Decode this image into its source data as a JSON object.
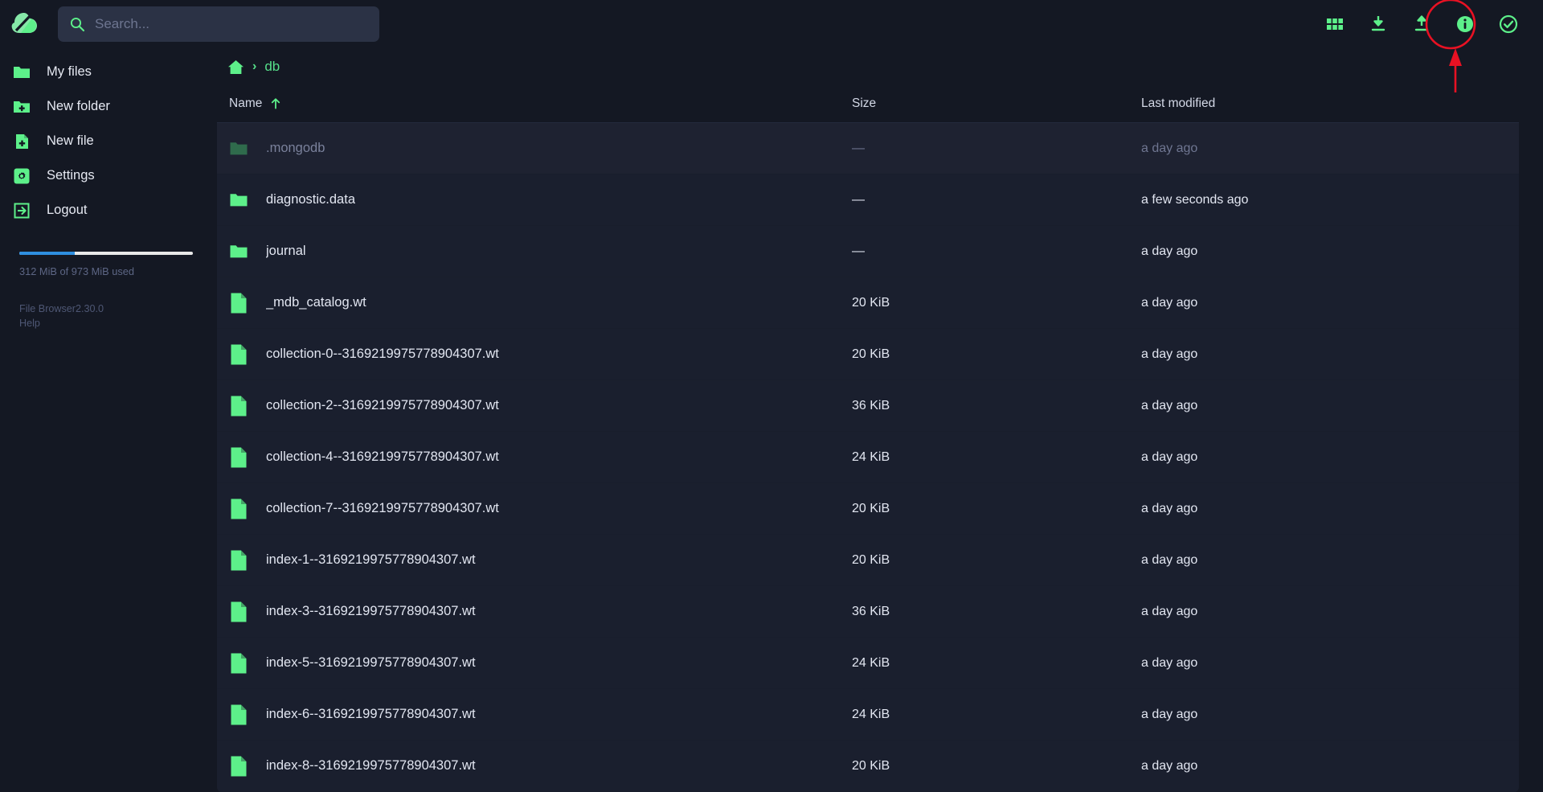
{
  "app": {
    "name": "File Browser",
    "version": "2.30.0",
    "help_label": "Help"
  },
  "search": {
    "placeholder": "Search...",
    "value": "",
    "icon": "search-icon"
  },
  "toolbar": {
    "items": [
      {
        "name": "switch-view-icon",
        "label": "Switch view"
      },
      {
        "name": "download-icon",
        "label": "Download"
      },
      {
        "name": "upload-icon",
        "label": "Upload"
      },
      {
        "name": "info-icon",
        "label": "Info"
      },
      {
        "name": "select-multiple-icon",
        "label": "Select multiple"
      }
    ],
    "highlighted": "upload-icon"
  },
  "sidebar": {
    "items": [
      {
        "icon": "folder-icon",
        "label": "My files"
      },
      {
        "icon": "folder-plus-icon",
        "label": "New folder"
      },
      {
        "icon": "file-plus-icon",
        "label": "New file"
      },
      {
        "icon": "gear-icon",
        "label": "Settings"
      },
      {
        "icon": "logout-icon",
        "label": "Logout"
      }
    ],
    "usage": {
      "text": "312 MiB of 973 MiB used",
      "percent": 32,
      "fill_color": "#2f8fe0",
      "track_color": "#e8e8e8"
    },
    "footer": {
      "version_line": "File Browser2.30.0",
      "help": "Help"
    }
  },
  "breadcrumb": {
    "home_icon": "home-icon",
    "separator": "›",
    "segments": [
      {
        "label": "db"
      }
    ]
  },
  "listing": {
    "columns": {
      "name": "Name",
      "size": "Size",
      "modified": "Last modified"
    },
    "sort": {
      "column": "Name",
      "direction": "asc",
      "icon": "arrow-up-icon"
    },
    "rows": [
      {
        "icon": "folder-icon",
        "type": "folder",
        "name": ".mongodb",
        "size": "—",
        "modified": "a day ago",
        "hidden": true
      },
      {
        "icon": "folder-icon",
        "type": "folder",
        "name": "diagnostic.data",
        "size": "—",
        "modified": "a few seconds ago",
        "hidden": false
      },
      {
        "icon": "folder-icon",
        "type": "folder",
        "name": "journal",
        "size": "—",
        "modified": "a day ago",
        "hidden": false
      },
      {
        "icon": "file-icon",
        "type": "file",
        "name": "_mdb_catalog.wt",
        "size": "20 KiB",
        "modified": "a day ago",
        "hidden": false
      },
      {
        "icon": "file-icon",
        "type": "file",
        "name": "collection-0--3169219975778904307.wt",
        "size": "20 KiB",
        "modified": "a day ago",
        "hidden": false
      },
      {
        "icon": "file-icon",
        "type": "file",
        "name": "collection-2--3169219975778904307.wt",
        "size": "36 KiB",
        "modified": "a day ago",
        "hidden": false
      },
      {
        "icon": "file-icon",
        "type": "file",
        "name": "collection-4--3169219975778904307.wt",
        "size": "24 KiB",
        "modified": "a day ago",
        "hidden": false
      },
      {
        "icon": "file-icon",
        "type": "file",
        "name": "collection-7--3169219975778904307.wt",
        "size": "20 KiB",
        "modified": "a day ago",
        "hidden": false
      },
      {
        "icon": "file-icon",
        "type": "file",
        "name": "index-1--3169219975778904307.wt",
        "size": "20 KiB",
        "modified": "a day ago",
        "hidden": false
      },
      {
        "icon": "file-icon",
        "type": "file",
        "name": "index-3--3169219975778904307.wt",
        "size": "36 KiB",
        "modified": "a day ago",
        "hidden": false
      },
      {
        "icon": "file-icon",
        "type": "file",
        "name": "index-5--3169219975778904307.wt",
        "size": "24 KiB",
        "modified": "a day ago",
        "hidden": false
      },
      {
        "icon": "file-icon",
        "type": "file",
        "name": "index-6--3169219975778904307.wt",
        "size": "24 KiB",
        "modified": "a day ago",
        "hidden": false
      },
      {
        "icon": "file-icon",
        "type": "file",
        "name": "index-8--3169219975778904307.wt",
        "size": "20 KiB",
        "modified": "a day ago",
        "hidden": false
      }
    ]
  },
  "annotation": {
    "shape": "circle-with-arrow",
    "color": "#e81123",
    "target": "upload-icon"
  },
  "colors": {
    "accent_green": "#5df08a",
    "background": "#141823",
    "row_background": "#1a1f2e",
    "hidden_row_background": "#1e2231",
    "text": "#e2e6f1",
    "muted_text": "#6f7691"
  }
}
